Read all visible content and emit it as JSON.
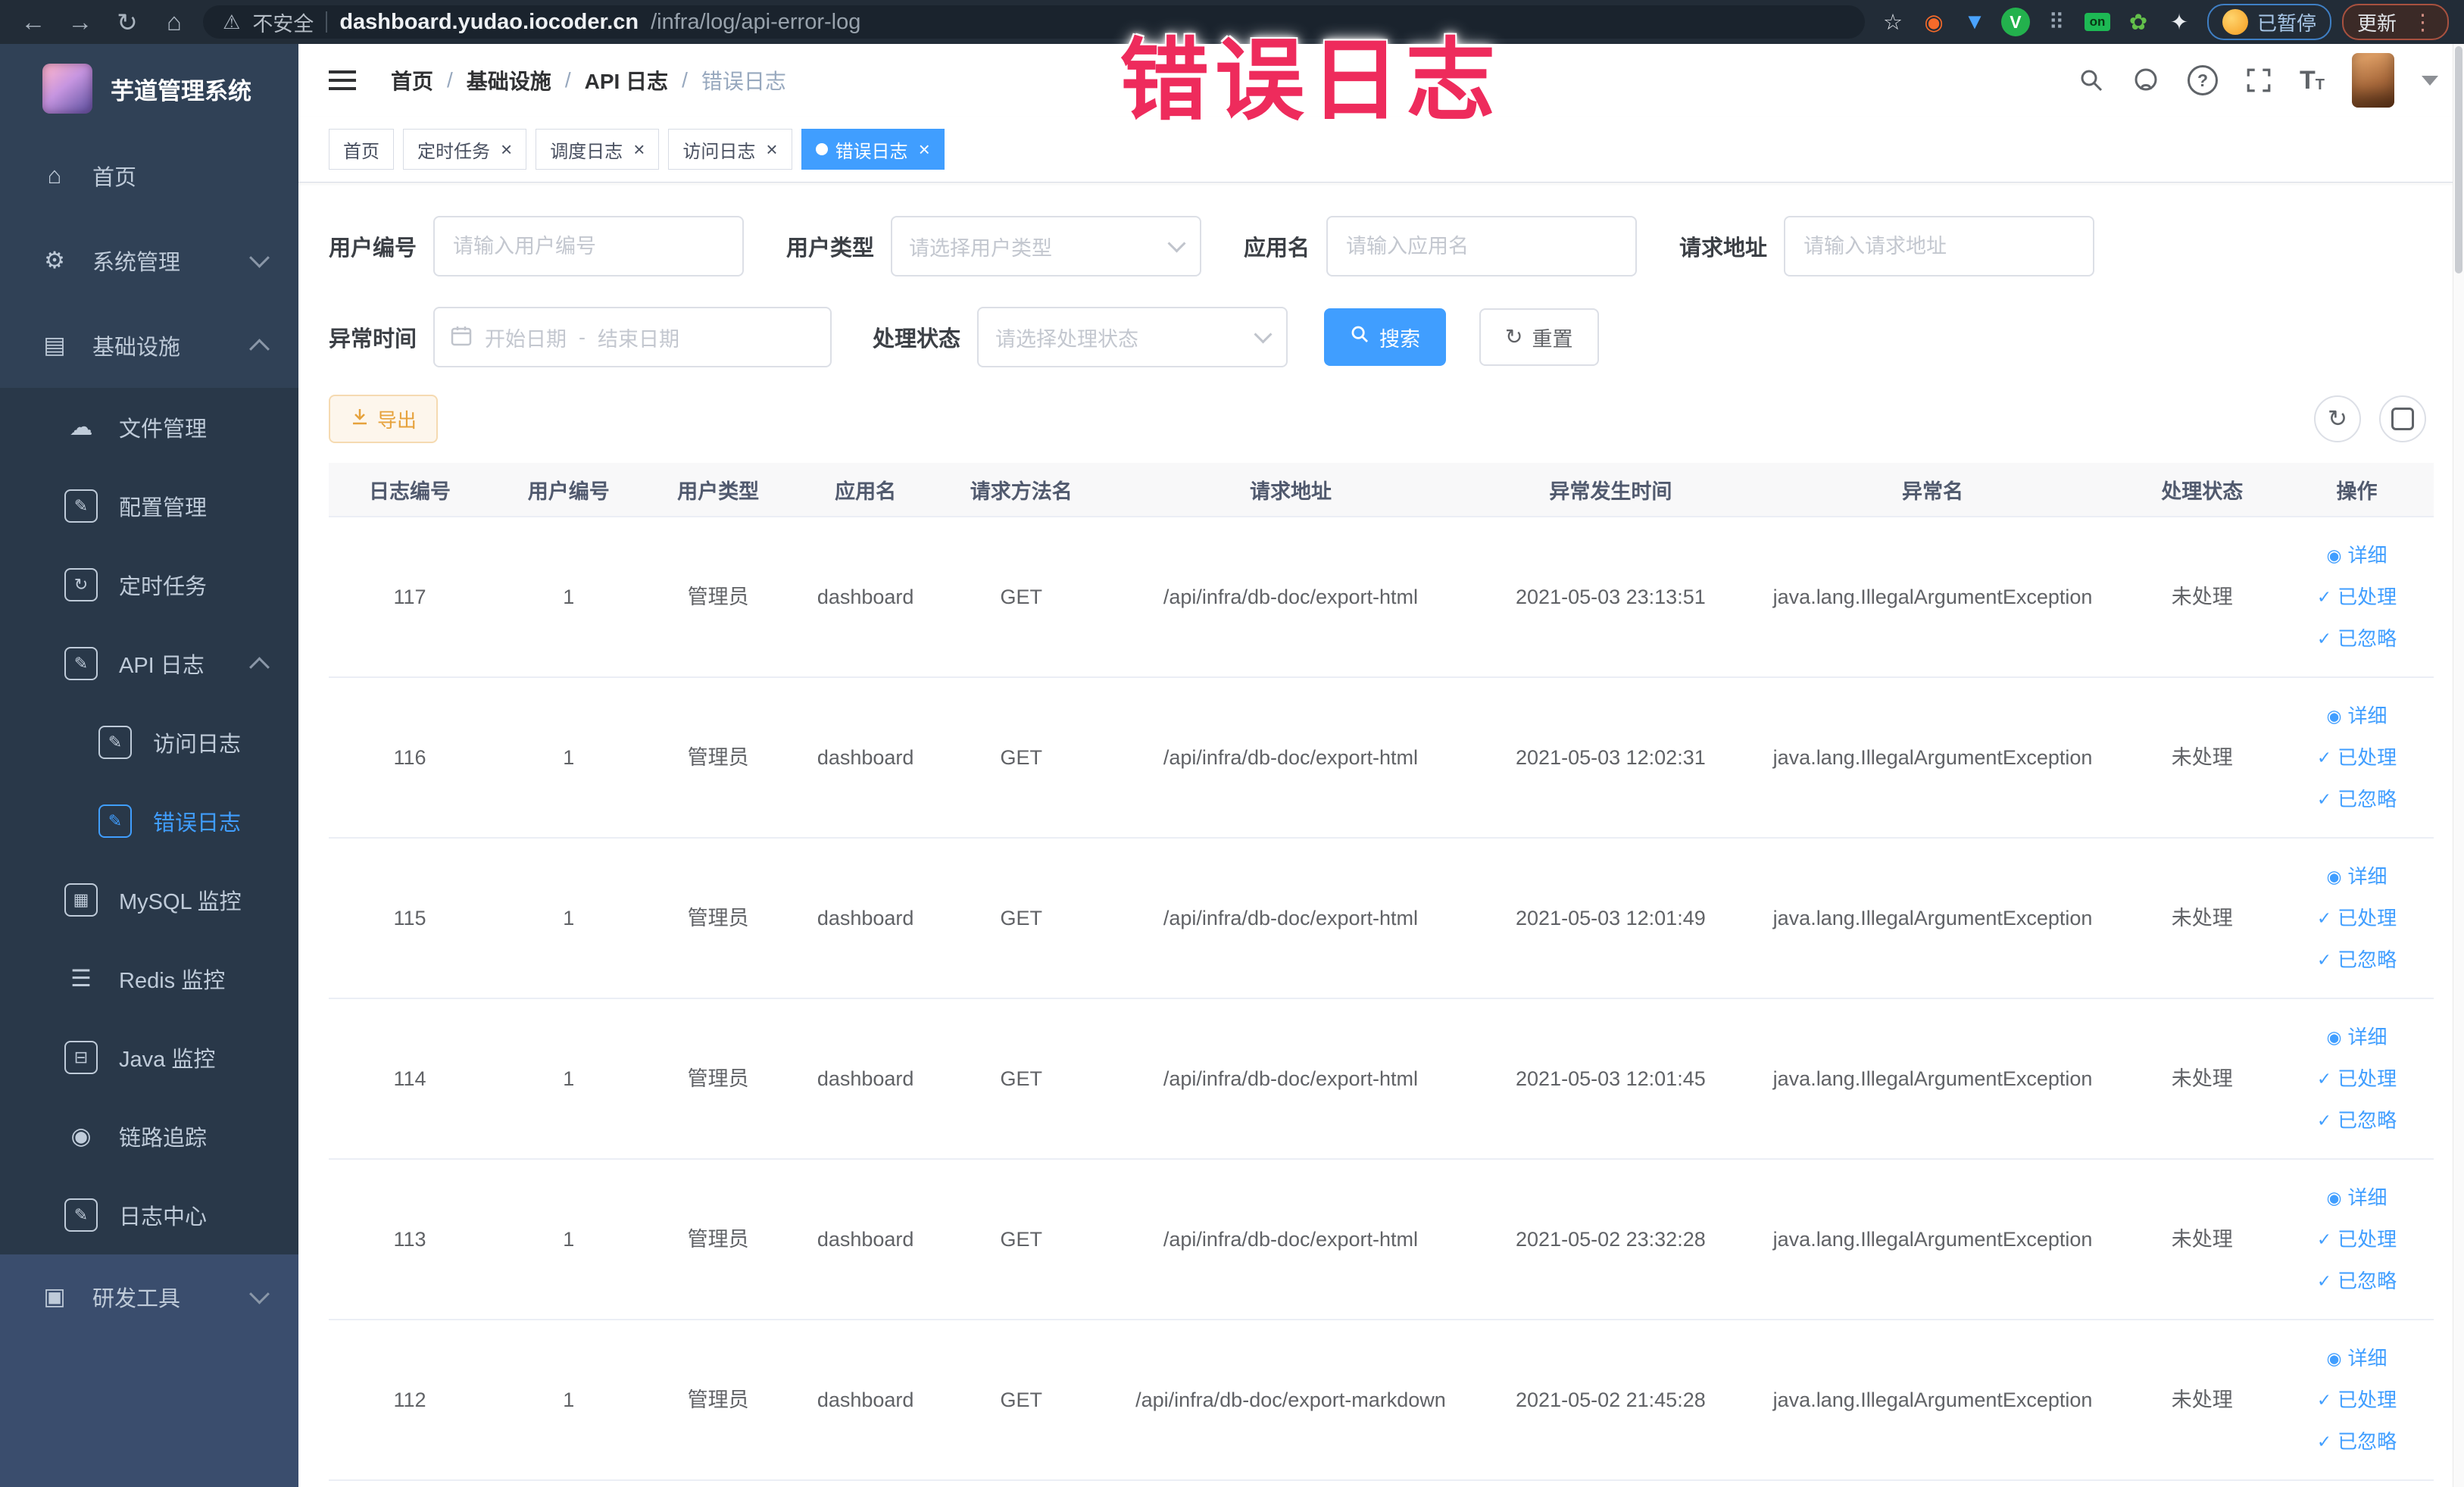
{
  "overlay": {
    "text": "错误日志",
    "color": "#ee2b5c"
  },
  "browser": {
    "back_glyph": "←",
    "forward_glyph": "→",
    "reload_glyph": "↻",
    "home_glyph": "⌂",
    "warning_glyph": "⚠",
    "security_label": "不安全",
    "url_host": "dashboard.yudao.iocoder.cn",
    "url_path": "/infra/log/api-error-log",
    "extensions": [
      {
        "icon": "bookmark-star-icon",
        "glyph": "☆",
        "color": "#dfe3e8"
      },
      {
        "icon": "adblock-extension-icon",
        "glyph": "◉",
        "color": "#f56a2a"
      },
      {
        "icon": "shield-extension-icon",
        "glyph": "▼",
        "color": "#4aa3ff"
      },
      {
        "icon": "v-extension-icon",
        "glyph": "V",
        "color": "#ffffff",
        "vbadge": true
      },
      {
        "icon": "grid-extension-icon",
        "glyph": "⠿",
        "color": "#9aa7b5"
      },
      {
        "icon": "switch-on-extension-icon",
        "glyph": "on",
        "color": "#0a3514",
        "onbadge": true
      },
      {
        "icon": "plant-extension-icon",
        "glyph": "✿",
        "color": "#63c04a"
      },
      {
        "icon": "puzzle-extension-icon",
        "glyph": "✦",
        "color": "#e8ecf0"
      }
    ],
    "paused_badge": "已暂停",
    "update_button": "更新",
    "kebab_glyph": "⋮"
  },
  "sidebar": {
    "logo_title": "芋道管理系统",
    "items": [
      {
        "label": "首页",
        "icon": "home-icon",
        "glyph": "⌂",
        "level": 0
      },
      {
        "label": "系统管理",
        "icon": "gear-icon",
        "glyph": "⚙",
        "level": 0,
        "chevron_down": true
      },
      {
        "label": "基础设施",
        "icon": "infrastructure-icon",
        "glyph": "▤",
        "level": 0,
        "chevron_up": true
      },
      {
        "label": "文件管理",
        "icon": "cloud-upload-icon",
        "glyph": "☁",
        "level": 1,
        "inblock": true
      },
      {
        "label": "配置管理",
        "icon": "config-edit-icon",
        "glyph": "✎",
        "level": 1,
        "inblock": true,
        "boxed": true
      },
      {
        "label": "定时任务",
        "icon": "timer-icon",
        "glyph": "↻",
        "level": 1,
        "inblock": true,
        "boxed": true
      },
      {
        "label": "API 日志",
        "icon": "api-log-icon",
        "glyph": "✎",
        "level": 1,
        "inblock": true,
        "boxed": true,
        "chevron_up": true
      },
      {
        "label": "访问日志",
        "icon": "access-log-icon",
        "glyph": "✎",
        "level": 2,
        "inblock": true,
        "boxed": true
      },
      {
        "label": "错误日志",
        "icon": "error-log-icon",
        "glyph": "✎",
        "level": 2,
        "inblock": true,
        "boxed": true,
        "active": true
      },
      {
        "label": "MySQL 监控",
        "icon": "mysql-monitor-icon",
        "glyph": "▦",
        "level": 1,
        "inblock": true,
        "boxed": true
      },
      {
        "label": "Redis 监控",
        "icon": "redis-monitor-icon",
        "glyph": "☰",
        "level": 1,
        "inblock": true
      },
      {
        "label": "Java 监控",
        "icon": "java-monitor-icon",
        "glyph": "⊟",
        "level": 1,
        "inblock": true,
        "boxed": true
      },
      {
        "label": "链路追踪",
        "icon": "trace-eye-icon",
        "glyph": "◉",
        "level": 1,
        "inblock": true
      },
      {
        "label": "日志中心",
        "icon": "log-center-icon",
        "glyph": "✎",
        "level": 1,
        "inblock": true,
        "boxed": true
      },
      {
        "label": "研发工具",
        "icon": "toolbox-icon",
        "glyph": "▣",
        "level": 0,
        "light": true,
        "chevron_down": true
      }
    ]
  },
  "header": {
    "help_glyph": "?",
    "fontsize_glyph": "T",
    "icons": [
      "search-icon",
      "github-icon",
      "help-icon",
      "fullscreen-icon",
      "fontsize-icon",
      "avatar",
      "caret-down-icon"
    ]
  },
  "breadcrumb": [
    {
      "label": "首页",
      "sep": "/"
    },
    {
      "label": "基础设施",
      "sep": "/"
    },
    {
      "label": "API 日志",
      "sep": "/"
    },
    {
      "label": "错误日志",
      "sep": "",
      "last": true
    }
  ],
  "tabs": [
    {
      "label": "首页"
    },
    {
      "label": "定时任务",
      "closable": true,
      "close": "×"
    },
    {
      "label": "调度日志",
      "closable": true,
      "close": "×"
    },
    {
      "label": "访问日志",
      "closable": true,
      "close": "×"
    },
    {
      "label": "错误日志",
      "closable": true,
      "close": "×",
      "active": true
    }
  ],
  "filters": {
    "fields": [
      {
        "label": "用户编号",
        "placeholder": "请输入用户编号"
      },
      {
        "label": "用户类型",
        "placeholder": "请选择用户类型",
        "select": true
      },
      {
        "label": "应用名",
        "placeholder": "请输入应用名"
      },
      {
        "label": "请求地址",
        "placeholder": "请输入请求地址"
      }
    ],
    "time": {
      "label": "异常时间",
      "start": "开始日期",
      "sep": "-",
      "end": "结束日期"
    },
    "status": {
      "label": "处理状态",
      "placeholder": "请选择处理状态"
    },
    "buttons": {
      "search": "搜索",
      "reset": "重置",
      "reset_icon_glyph": "↻"
    }
  },
  "toolbar": {
    "export": "导出",
    "refresh_icon_glyph": "↻"
  },
  "table": {
    "columns": [
      "日志编号",
      "用户编号",
      "用户类型",
      "应用名",
      "请求方法名",
      "请求地址",
      "异常发生时间",
      "异常名",
      "处理状态",
      "操作"
    ],
    "actions": [
      {
        "label": "详细",
        "icon": "eye-icon",
        "glyph": "◉"
      },
      {
        "label": "已处理",
        "icon": "check-icon",
        "glyph": "✓"
      },
      {
        "label": "已忽略",
        "icon": "check-icon",
        "glyph": "✓"
      }
    ],
    "rows": [
      {
        "id": "117",
        "user_id": "1",
        "user_type": "管理员",
        "app": "dashboard",
        "method": "GET",
        "url": "/api/infra/db-doc/export-html",
        "time": "2021-05-03 23:13:51",
        "exception": "java.lang.IllegalArgumentException",
        "status": "未处理"
      },
      {
        "id": "116",
        "user_id": "1",
        "user_type": "管理员",
        "app": "dashboard",
        "method": "GET",
        "url": "/api/infra/db-doc/export-html",
        "time": "2021-05-03 12:02:31",
        "exception": "java.lang.IllegalArgumentException",
        "status": "未处理"
      },
      {
        "id": "115",
        "user_id": "1",
        "user_type": "管理员",
        "app": "dashboard",
        "method": "GET",
        "url": "/api/infra/db-doc/export-html",
        "time": "2021-05-03 12:01:49",
        "exception": "java.lang.IllegalArgumentException",
        "status": "未处理"
      },
      {
        "id": "114",
        "user_id": "1",
        "user_type": "管理员",
        "app": "dashboard",
        "method": "GET",
        "url": "/api/infra/db-doc/export-html",
        "time": "2021-05-03 12:01:45",
        "exception": "java.lang.IllegalArgumentException",
        "status": "未处理"
      },
      {
        "id": "113",
        "user_id": "1",
        "user_type": "管理员",
        "app": "dashboard",
        "method": "GET",
        "url": "/api/infra/db-doc/export-html",
        "time": "2021-05-02 23:32:28",
        "exception": "java.lang.IllegalArgumentException",
        "status": "未处理"
      },
      {
        "id": "112",
        "user_id": "1",
        "user_type": "管理员",
        "app": "dashboard",
        "method": "GET",
        "url": "/api/infra/db-doc/export-markdown",
        "time": "2021-05-02 21:45:28",
        "exception": "java.lang.IllegalArgumentException",
        "status": "未处理"
      }
    ]
  },
  "colors": {
    "accent": "#409eff",
    "warning_button": "#e6a23c",
    "annotation": "#ee2b5c",
    "sidebar_bg": "#304156"
  }
}
